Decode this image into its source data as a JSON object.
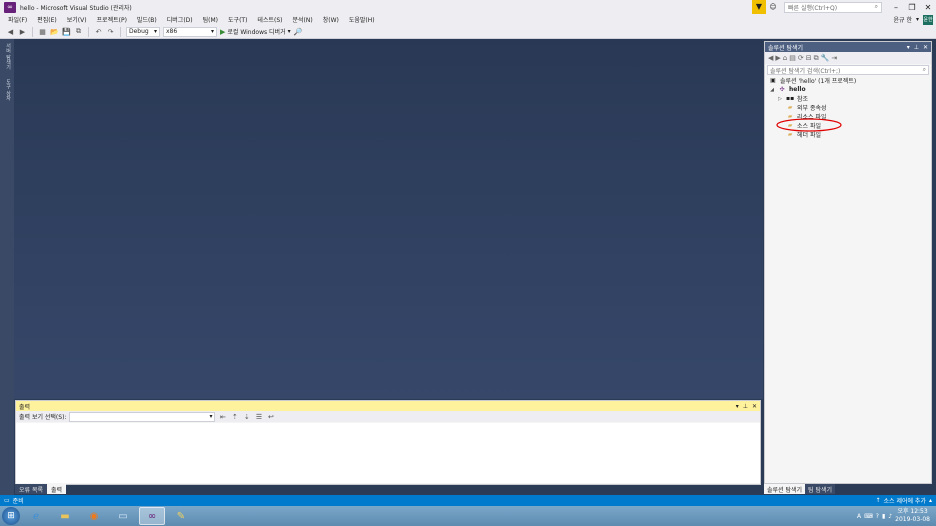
{
  "window": {
    "title": "hello - Microsoft Visual Studio (관리자)",
    "quicklaunch_placeholder": "빠른 실행(Ctrl+Q)"
  },
  "menu": {
    "items": [
      "파일(F)",
      "편집(E)",
      "보기(V)",
      "프로젝트(P)",
      "빌드(B)",
      "디버그(D)",
      "팀(M)",
      "도구(T)",
      "테스트(S)",
      "분석(N)",
      "창(W)",
      "도움말(H)"
    ],
    "user": "윤규 한",
    "user_initials": "윤한"
  },
  "toolbar": {
    "config": "Debug",
    "platform": "x86",
    "run_label": "로컬 Windows 디버거"
  },
  "left_tabs": [
    "서버 탐색기",
    "도구 상자"
  ],
  "output_panel": {
    "title": "출력",
    "source_label": "출력 보기 선택(S):",
    "tabs": [
      "오류 목록",
      "출력"
    ]
  },
  "solution_explorer": {
    "title": "솔루션 탐색기",
    "search_placeholder": "솔루션 탐색기 검색(Ctrl+;)",
    "solution_node": "솔루션 'hello' (1개 프로젝트)",
    "project_node": "hello",
    "children": [
      "참조",
      "외부 종속성",
      "리소스 파일",
      "소스 파일",
      "헤더 파일"
    ],
    "tabs": [
      "솔루션 탐색기",
      "팀 탐색기"
    ]
  },
  "status": {
    "left": "준비",
    "right": "소스 제어에 추가"
  },
  "taskbar": {
    "time": "오후 12:53",
    "date": "2019-03-08"
  },
  "colors": {
    "accent": "#007acc",
    "editor_bg": "#2b3a55",
    "annotation": "#e00000"
  }
}
